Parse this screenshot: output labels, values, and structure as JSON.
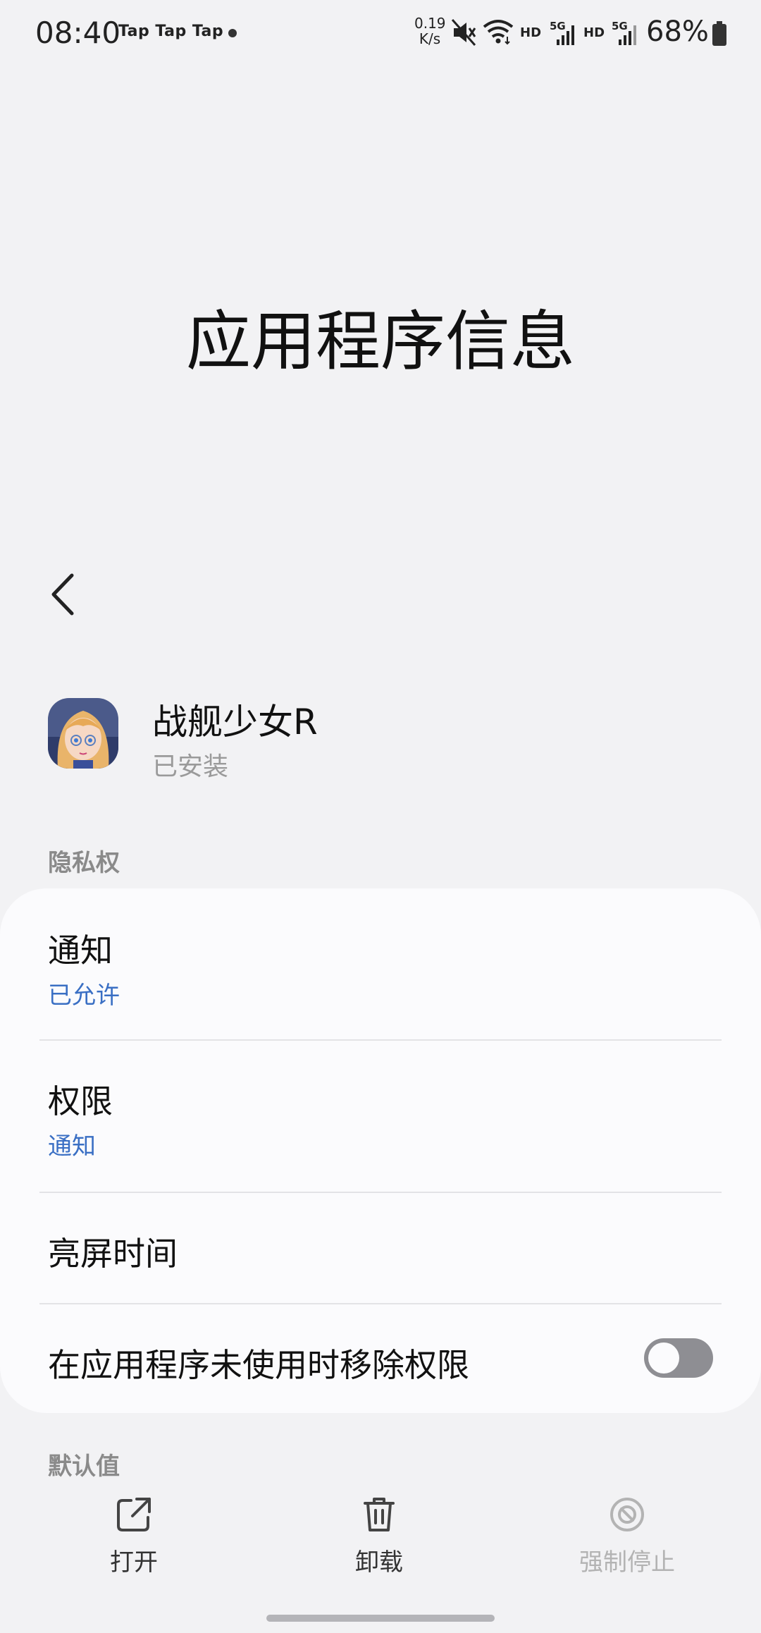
{
  "status_bar": {
    "time": "08:40",
    "notification_text": "Tap Tap Tap",
    "net_speed_value": "0.19",
    "net_speed_unit": "K/s",
    "hd_label_1": "HD",
    "hd_label_2": "HD",
    "network_label_1": "5G",
    "network_label_2": "5G",
    "battery": "68%",
    "icons": [
      "mute-icon",
      "wifi-icon",
      "signal-icon",
      "signal-icon",
      "battery-icon"
    ]
  },
  "page": {
    "title": "应用程序信息"
  },
  "app": {
    "name": "战舰少女R",
    "status": "已安装"
  },
  "sections": {
    "privacy_label": "隐私权",
    "defaults_label": "默认值"
  },
  "privacy_items": [
    {
      "title": "通知",
      "subtitle": "已允许"
    },
    {
      "title": "权限",
      "subtitle": "通知"
    },
    {
      "title": "亮屏时间"
    },
    {
      "title": "在应用程序未使用时移除权限",
      "toggle_on": false
    }
  ],
  "bottom_actions": [
    {
      "label": "打开",
      "icon": "open-external-icon",
      "enabled": true
    },
    {
      "label": "卸载",
      "icon": "trash-icon",
      "enabled": true
    },
    {
      "label": "强制停止",
      "icon": "force-stop-icon",
      "enabled": false
    }
  ],
  "colors": {
    "accent": "#3a6fc4",
    "background": "#f2f2f4",
    "card": "#fbfbfd",
    "toggle_off": "#8e8e93"
  }
}
